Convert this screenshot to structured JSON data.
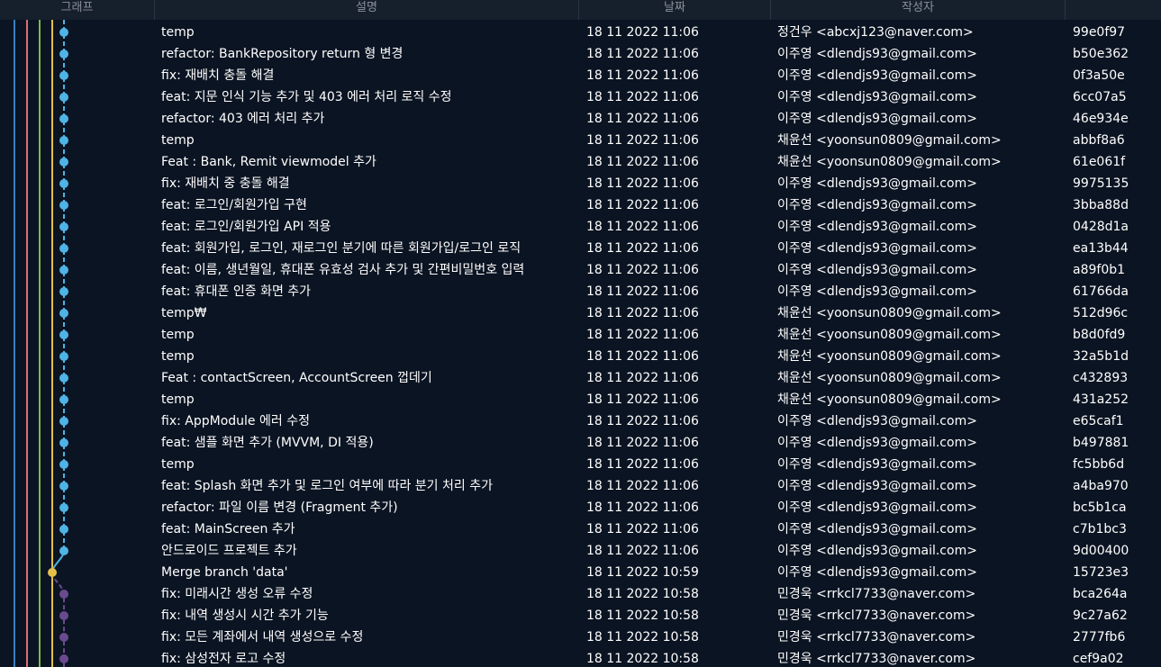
{
  "header": {
    "graph": "그래프",
    "description": "설명",
    "date": "날짜",
    "author": "작성자"
  },
  "colors": {
    "background": "#0b1422",
    "header_bg": "#16202d",
    "lane_blue": "#3a7fc4",
    "lane_red": "#e06c75",
    "lane_green": "#7fba4a",
    "lane_yellow": "#e5c04a",
    "branch_main": "#4fb3e6",
    "branch_purple": "#6a4a8e"
  },
  "commits": [
    {
      "desc": "temp",
      "date": "18 11 2022 11:06",
      "author": "정건우 <abcxj123@naver.com>",
      "hash": "99e0f97",
      "branch": "main"
    },
    {
      "desc": "refactor: BankRepository return 형 변경",
      "date": "18 11 2022 11:06",
      "author": "이주영 <dlendjs93@gmail.com>",
      "hash": "b50e362",
      "branch": "main"
    },
    {
      "desc": "fix: 재배치 충돌 해결",
      "date": "18 11 2022 11:06",
      "author": "이주영 <dlendjs93@gmail.com>",
      "hash": "0f3a50e",
      "branch": "main"
    },
    {
      "desc": "feat: 지문 인식 기능 추가 및 403 에러 처리 로직 수정",
      "date": "18 11 2022 11:06",
      "author": "이주영 <dlendjs93@gmail.com>",
      "hash": "6cc07a5",
      "branch": "main"
    },
    {
      "desc": "refactor: 403 에러 처리 추가",
      "date": "18 11 2022 11:06",
      "author": "이주영 <dlendjs93@gmail.com>",
      "hash": "46e934e",
      "branch": "main"
    },
    {
      "desc": "temp",
      "date": "18 11 2022 11:06",
      "author": "채윤선 <yoonsun0809@gmail.com>",
      "hash": "abbf8a6",
      "branch": "main"
    },
    {
      "desc": "Feat : Bank, Remit viewmodel 추가",
      "date": "18 11 2022 11:06",
      "author": "채윤선 <yoonsun0809@gmail.com>",
      "hash": "61e061f",
      "branch": "main"
    },
    {
      "desc": "fix: 재배치 중 충돌 해결",
      "date": "18 11 2022 11:06",
      "author": "이주영 <dlendjs93@gmail.com>",
      "hash": "9975135",
      "branch": "main"
    },
    {
      "desc": "feat: 로그인/회원가입 구현",
      "date": "18 11 2022 11:06",
      "author": "이주영 <dlendjs93@gmail.com>",
      "hash": "3bba88d",
      "branch": "main"
    },
    {
      "desc": "feat: 로그인/회원가입 API 적용",
      "date": "18 11 2022 11:06",
      "author": "이주영 <dlendjs93@gmail.com>",
      "hash": "0428d1a",
      "branch": "main"
    },
    {
      "desc": "feat: 회원가입, 로그인, 재로그인 분기에 따른 회원가입/로그인 로직",
      "date": "18 11 2022 11:06",
      "author": "이주영 <dlendjs93@gmail.com>",
      "hash": "ea13b44",
      "branch": "main"
    },
    {
      "desc": "feat: 이름, 생년월일, 휴대폰 유효성 검사 추가 및 간편비밀번호 입력",
      "date": "18 11 2022 11:06",
      "author": "이주영 <dlendjs93@gmail.com>",
      "hash": "a89f0b1",
      "branch": "main"
    },
    {
      "desc": "feat: 휴대폰 인증 화면 추가",
      "date": "18 11 2022 11:06",
      "author": "이주영 <dlendjs93@gmail.com>",
      "hash": "61766da",
      "branch": "main"
    },
    {
      "desc": "temp₩",
      "date": "18 11 2022 11:06",
      "author": "채윤선 <yoonsun0809@gmail.com>",
      "hash": "512d96c",
      "branch": "main"
    },
    {
      "desc": "temp",
      "date": "18 11 2022 11:06",
      "author": "채윤선 <yoonsun0809@gmail.com>",
      "hash": "b8d0fd9",
      "branch": "main"
    },
    {
      "desc": "temp",
      "date": "18 11 2022 11:06",
      "author": "채윤선 <yoonsun0809@gmail.com>",
      "hash": "32a5b1d",
      "branch": "main"
    },
    {
      "desc": "Feat : contactScreen, AccountScreen 껍데기",
      "date": "18 11 2022 11:06",
      "author": "채윤선 <yoonsun0809@gmail.com>",
      "hash": "c432893",
      "branch": "main"
    },
    {
      "desc": "temp",
      "date": "18 11 2022 11:06",
      "author": "채윤선 <yoonsun0809@gmail.com>",
      "hash": "431a252",
      "branch": "main"
    },
    {
      "desc": "fix: AppModule 에러 수정",
      "date": "18 11 2022 11:06",
      "author": "이주영 <dlendjs93@gmail.com>",
      "hash": "e65caf1",
      "branch": "main"
    },
    {
      "desc": "feat: 샘플 화면 추가 (MVVM, DI 적용)",
      "date": "18 11 2022 11:06",
      "author": "이주영 <dlendjs93@gmail.com>",
      "hash": "b497881",
      "branch": "main"
    },
    {
      "desc": "temp",
      "date": "18 11 2022 11:06",
      "author": "이주영 <dlendjs93@gmail.com>",
      "hash": "fc5bb6d",
      "branch": "main"
    },
    {
      "desc": "feat: Splash 화면 추가 및 로그인 여부에 따라 분기 처리 추가",
      "date": "18 11 2022 11:06",
      "author": "이주영 <dlendjs93@gmail.com>",
      "hash": "a4ba970",
      "branch": "main"
    },
    {
      "desc": "refactor: 파일 이름 변경 (Fragment 추가)",
      "date": "18 11 2022 11:06",
      "author": "이주영 <dlendjs93@gmail.com>",
      "hash": "bc5b1ca",
      "branch": "main"
    },
    {
      "desc": "feat: MainScreen 추가",
      "date": "18 11 2022 11:06",
      "author": "이주영 <dlendjs93@gmail.com>",
      "hash": "c7b1bc3",
      "branch": "main"
    },
    {
      "desc": "안드로이드 프로젝트 추가",
      "date": "18 11 2022 11:06",
      "author": "이주영 <dlendjs93@gmail.com>",
      "hash": "9d00400",
      "branch": "main"
    },
    {
      "desc": "Merge branch 'data'",
      "date": "18 11 2022 10:59",
      "author": "이주영 <dlendjs93@gmail.com>",
      "hash": "15723e3",
      "branch": "merge"
    },
    {
      "desc": "fix: 미래시간 생성 오류 수정",
      "date": "18 11 2022 10:58",
      "author": "민경욱 <rrkcl7733@naver.com>",
      "hash": "bca264a",
      "branch": "data"
    },
    {
      "desc": "fix: 내역 생성시 시간 추가 기능",
      "date": "18 11 2022 10:58",
      "author": "민경욱 <rrkcl7733@naver.com>",
      "hash": "9c27a62",
      "branch": "data"
    },
    {
      "desc": "fix: 모든 계좌에서 내역 생성으로 수정",
      "date": "18 11 2022 10:58",
      "author": "민경욱 <rrkcl7733@naver.com>",
      "hash": "2777fb6",
      "branch": "data"
    },
    {
      "desc": "fix: 삼성전자 로고 수정",
      "date": "18 11 2022 10:58",
      "author": "민경욱 <rrkcl7733@naver.com>",
      "hash": "cef9a02",
      "branch": "data"
    }
  ]
}
